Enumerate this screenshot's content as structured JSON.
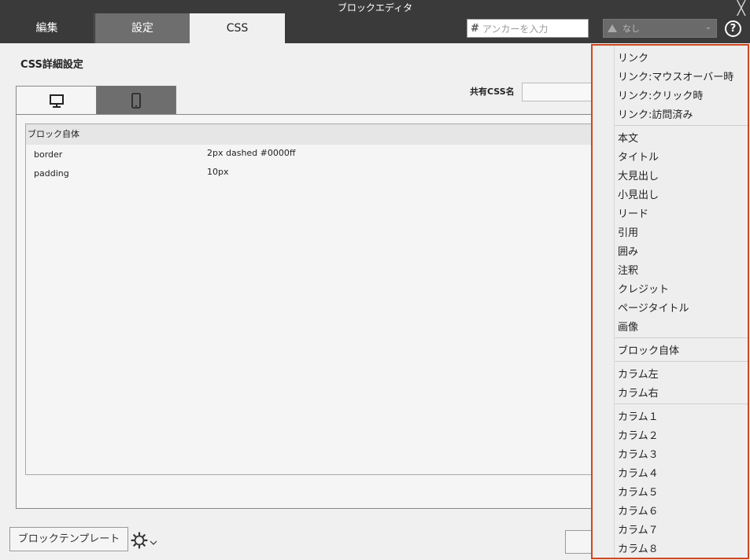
{
  "window": {
    "title": "ブロックエディタ",
    "close_glyph": "╳"
  },
  "tabs": {
    "edit": "編集",
    "settings": "設定",
    "css": "CSS"
  },
  "anchor": {
    "placeholder": "アンカーを入力",
    "hash": "#"
  },
  "style_select": {
    "value": "なし"
  },
  "help": {
    "glyph": "?"
  },
  "section_title": "CSS詳細設定",
  "shared_css": {
    "label": "共有CSS名"
  },
  "properties": {
    "group_header": "ブロック自体",
    "rows": [
      {
        "name": "border",
        "value": "2px dashed #0000ff"
      },
      {
        "name": "padding",
        "value": "10px"
      }
    ]
  },
  "footer": {
    "template_button": "ブロックテンプレート"
  },
  "menu": {
    "group1": [
      "リンク",
      "リンク:マウスオーバー時",
      "リンク:クリック時",
      "リンク:訪問済み"
    ],
    "group2": [
      "本文",
      "タイトル",
      "大見出し",
      "小見出し",
      "リード",
      "引用",
      "囲み",
      "注釈",
      "クレジット",
      "ページタイトル",
      "画像"
    ],
    "group3": [
      "ブロック自体"
    ],
    "group4": [
      "カラム左",
      "カラム右"
    ],
    "group5": [
      "カラム１",
      "カラム２",
      "カラム３",
      "カラム４",
      "カラム５",
      "カラム６",
      "カラム７",
      "カラム８"
    ]
  },
  "colors": {
    "menu_border": "#d0461e",
    "titlebar": "#3a3a3a"
  }
}
